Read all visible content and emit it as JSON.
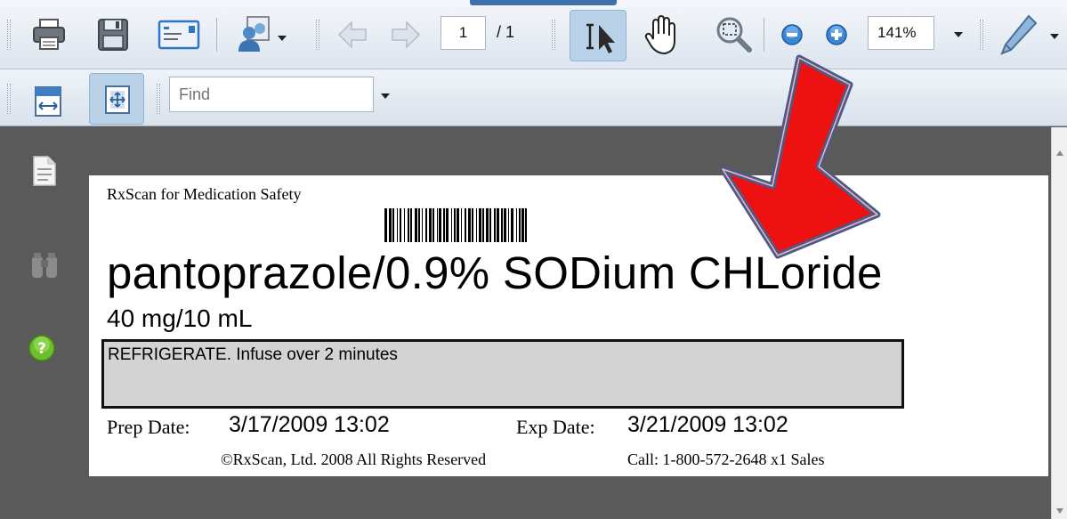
{
  "toolbar": {
    "page_current": "1",
    "page_total": "/ 1",
    "zoom": "141%",
    "find_placeholder": "Find"
  },
  "label": {
    "header": "RxScan for Medication Safety",
    "drug_name": "pantoprazole/0.9% SODium CHLoride",
    "dose": "40 mg/10 mL",
    "instructions": "REFRIGERATE. Infuse over 2 minutes",
    "prep_label": "Prep Date:",
    "prep_value": "3/17/2009 13:02",
    "exp_label": "Exp Date:",
    "exp_value": "3/21/2009 13:02",
    "copyright": "©RxScan, Ltd. 2008 All Rights Reserved",
    "call": "Call: 1-800-572-2648 x1 Sales"
  },
  "icons": [
    "print-icon",
    "save-icon",
    "email-icon",
    "users-icon",
    "back-arrow-icon",
    "forward-arrow-icon",
    "select-text-icon",
    "hand-icon",
    "marquee-zoom-icon",
    "zoom-out-icon",
    "zoom-in-icon",
    "pen-icon",
    "fit-width-icon",
    "fit-page-icon",
    "pages-icon",
    "binoculars-icon",
    "help-icon",
    "annotation-arrow"
  ],
  "colors": {
    "annotation_arrow": "#ee1111",
    "arrow_outline": "#4a5b8a",
    "label_box": "#d3d3d3"
  }
}
